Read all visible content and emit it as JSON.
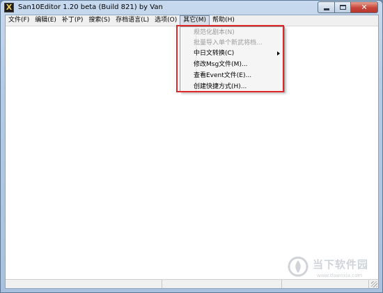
{
  "window": {
    "title": "San10Editor 1.20 beta (Build 821) by Van",
    "icon": "X"
  },
  "menubar": [
    {
      "label": "文件(F)"
    },
    {
      "label": "编辑(E)"
    },
    {
      "label": "补丁(P)"
    },
    {
      "label": "搜索(S)"
    },
    {
      "label": "存档语言(L)"
    },
    {
      "label": "选项(O)"
    },
    {
      "label": "其它(M)"
    },
    {
      "label": "帮助(H)"
    }
  ],
  "dropdown": {
    "parent": "其它(M)",
    "items": [
      {
        "label": "规范化剧本(N)",
        "disabled": true
      },
      {
        "label": "批量导入单个新武将档...",
        "disabled": true
      },
      {
        "label": "中日文转换(C)",
        "disabled": false,
        "submenu": true
      },
      {
        "label": "修改Msg文件(M)...",
        "disabled": false
      },
      {
        "label": "查看Event文件(E)...",
        "disabled": false
      },
      {
        "label": "创建快捷方式(H)...",
        "disabled": false
      }
    ]
  },
  "watermark": {
    "title": "当下软件园",
    "url": "www.downxia.com"
  },
  "colors": {
    "highlight_frame": "#e1262a",
    "close_button": "#c7453a",
    "titlebar": "#b5cbe4"
  }
}
